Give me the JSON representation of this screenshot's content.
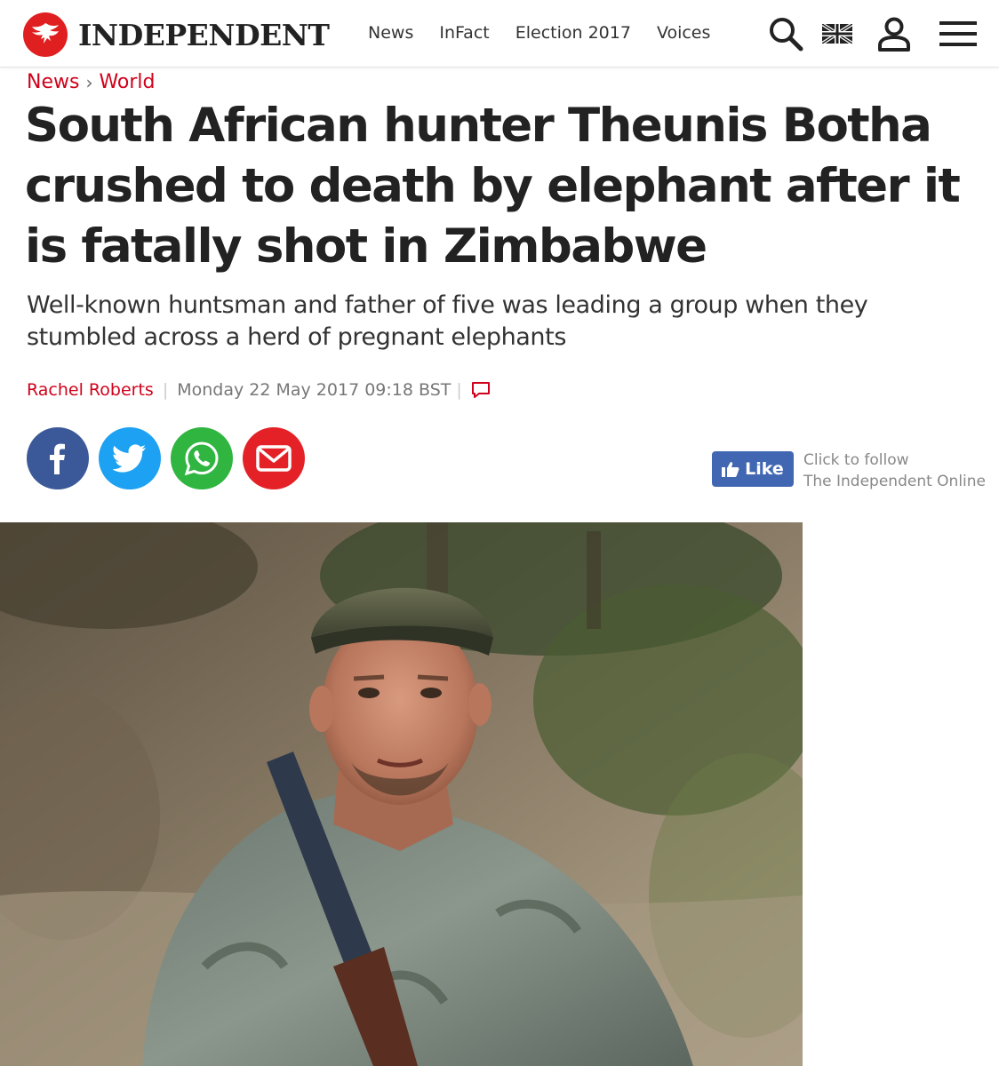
{
  "brand": {
    "name": "INDEPENDENT",
    "accent": "#d0021b"
  },
  "nav": [
    {
      "label": "News"
    },
    {
      "label": "InFact"
    },
    {
      "label": "Election 2017"
    },
    {
      "label": "Voices"
    }
  ],
  "header_icons": [
    "search-icon",
    "uk-flag-icon",
    "user-icon",
    "menu-icon"
  ],
  "breadcrumb": {
    "items": [
      "News",
      "World"
    ],
    "separator": "›"
  },
  "article": {
    "headline": "South African hunter Theunis Botha crushed to death by elephant after it is fatally shot in Zimbabwe",
    "standfirst": "Well-known huntsman and father of five was leading a group when they stumbled across a herd of pregnant elephants",
    "author": "Rachel Roberts",
    "date": "Monday 22 May 2017 09:18 BST"
  },
  "share": [
    {
      "network": "facebook",
      "icon": "facebook-icon",
      "color": "#3b5998"
    },
    {
      "network": "twitter",
      "icon": "twitter-icon",
      "color": "#1da1f2"
    },
    {
      "network": "whatsapp",
      "icon": "whatsapp-icon",
      "color": "#2fb540"
    },
    {
      "network": "email",
      "icon": "email-icon",
      "color": "#e52128"
    }
  ],
  "facebook_like": {
    "label": "Like",
    "follow_line1": "Click to follow",
    "follow_line2": "The Independent Online"
  }
}
